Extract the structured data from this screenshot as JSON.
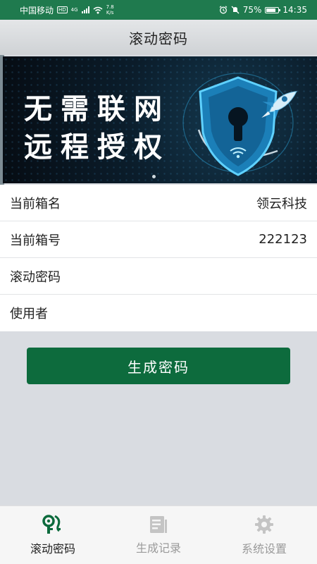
{
  "status_bar": {
    "carrier": "中国移动",
    "network_badge": "HD",
    "network_type": "4G",
    "speed_value": "7.8",
    "speed_unit": "K/s",
    "battery": "75%",
    "time": "14:35"
  },
  "header": {
    "title": "滚动密码"
  },
  "banner": {
    "line1": "无需联网",
    "line2": "远程授权",
    "carousel_dots": 1
  },
  "info": [
    {
      "label": "当前箱名",
      "value": "领云科技"
    },
    {
      "label": "当前箱号",
      "value": "222123"
    },
    {
      "label": "滚动密码",
      "value": ""
    },
    {
      "label": "使用者",
      "value": ""
    }
  ],
  "generate_button": {
    "label": "生成密码"
  },
  "tabs": [
    {
      "label": "滚动密码",
      "icon": "key-icon",
      "active": true
    },
    {
      "label": "生成记录",
      "icon": "record-list-icon",
      "active": false
    },
    {
      "label": "系统设置",
      "icon": "gear-icon",
      "active": false
    }
  ],
  "colors": {
    "status_bar": "#1f7a4e",
    "primary_button": "#0d6b3d",
    "active_icon": "#0d6b3d",
    "inactive": "#9a9a9a",
    "background": "#d9dce1"
  }
}
